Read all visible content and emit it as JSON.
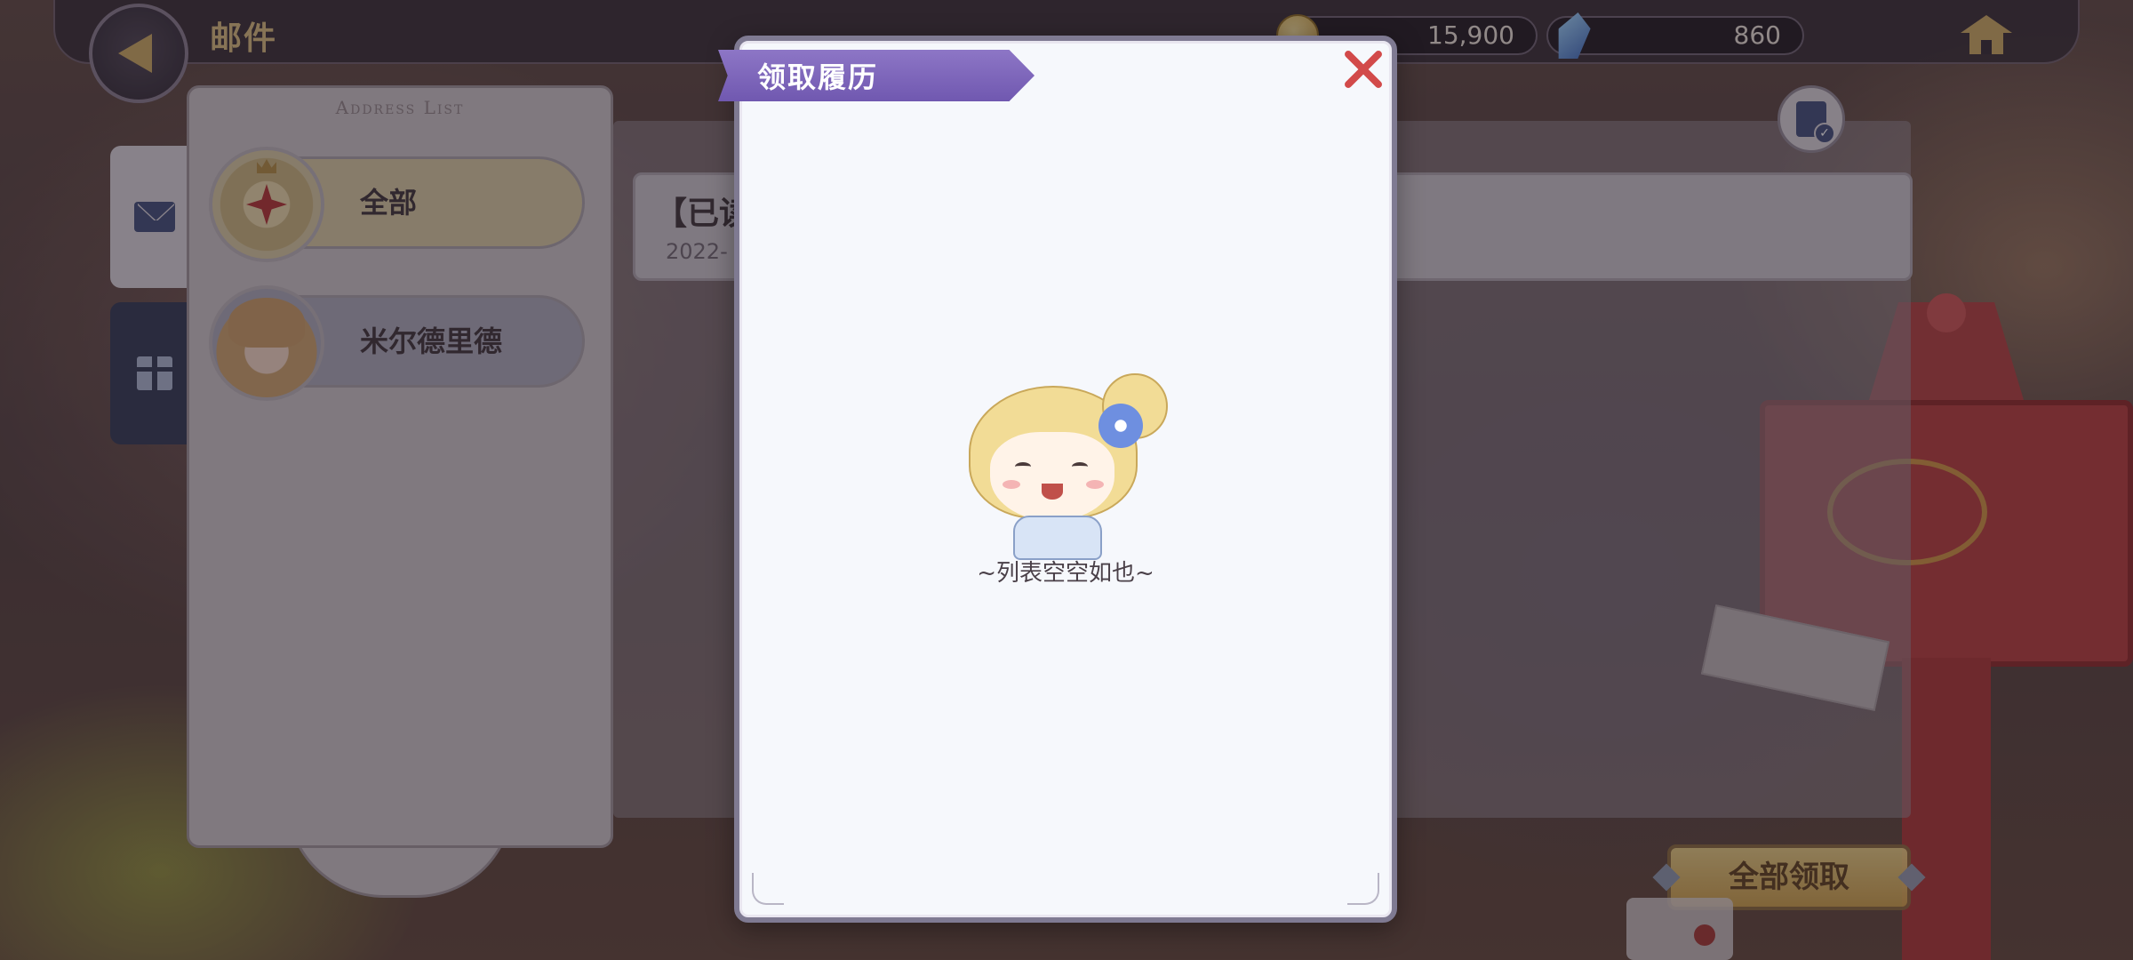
{
  "header": {
    "title": "邮件",
    "gold_amount": "15,900",
    "gem_amount": "860"
  },
  "address_list": {
    "title": "Address List",
    "contacts": [
      {
        "name": "全部"
      },
      {
        "name": "米尔德里德"
      }
    ]
  },
  "mail": {
    "item_status": "【已读",
    "item_date": "2022-"
  },
  "buttons": {
    "claim_all": "全部领取"
  },
  "modal": {
    "title": "领取履历",
    "empty_message": "~列表空空如也~"
  }
}
